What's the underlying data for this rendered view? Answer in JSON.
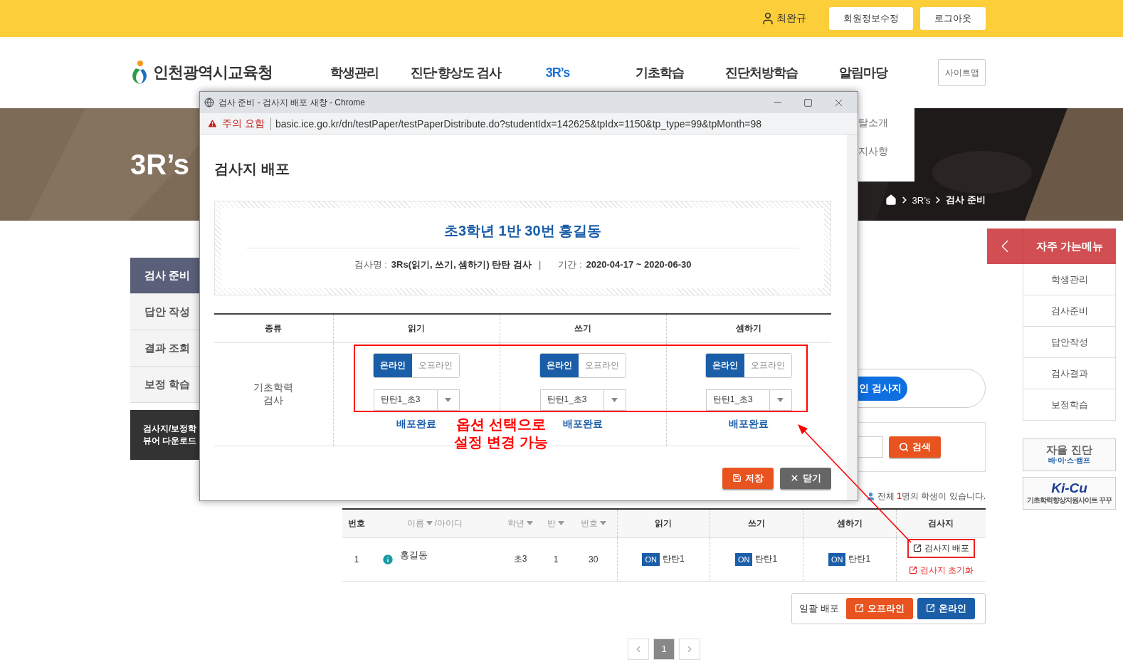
{
  "top_bar": {
    "user_name": "최완규",
    "buttons": [
      "회원정보수정",
      "로그아웃"
    ]
  },
  "header": {
    "logo_text": "인천광역시교육청",
    "nav": [
      {
        "label": "학생관리",
        "selected": false
      },
      {
        "label": "진단·향상도 검사",
        "selected": false
      },
      {
        "label": "3R’s",
        "selected": true
      },
      {
        "label": "기초학습",
        "selected": false
      },
      {
        "label": "진단처방학습",
        "selected": false
      },
      {
        "label": "알림마당",
        "selected": false
      }
    ],
    "sitemap_button": "사이트맵"
  },
  "submenu_fragments": [
    "탈소개",
    "지사항"
  ],
  "banner": {
    "title": "3R’s",
    "breadcrumb": [
      "3R’s",
      "검사 준비"
    ]
  },
  "sidebar": {
    "items": [
      {
        "label": "검사 준비",
        "selected": true
      },
      {
        "label": "답안 작성",
        "selected": false
      },
      {
        "label": "결과 조회",
        "selected": false
      },
      {
        "label": "보정 학습",
        "selected": false
      }
    ],
    "download_banner": "검사지/보정학\n뷰어 다운로드"
  },
  "main": {
    "type_options": [
      {
        "label": "인 검사지",
        "selected": true
      }
    ],
    "search_button": "검색",
    "count": "전체 **1**명의 학생이 있습니다.",
    "table": {
      "columns": [
        {
          "label": "번호",
          "sortable": false
        },
        {
          "label": "이름",
          "sortable": true,
          "suffix": "/아이디"
        },
        {
          "label": "학년",
          "sortable": true
        },
        {
          "label": "반",
          "sortable": true
        },
        {
          "label": "번호",
          "sortable": true
        },
        {
          "label": "읽기",
          "sortable": false
        },
        {
          "label": "쓰기",
          "sortable": false
        },
        {
          "label": "셈하기",
          "sortable": false
        },
        {
          "label": "검사지",
          "sortable": false
        }
      ],
      "rows": [
        {
          "no": "1",
          "name": "홍길동",
          "grade": "초3",
          "class": "1",
          "number": "30",
          "subjects": [
            {
              "mode": "ON",
              "paper": "탄탄1"
            },
            {
              "mode": "ON",
              "paper": "탄탄1"
            },
            {
              "mode": "ON",
              "paper": "탄탄1"
            }
          ],
          "actions": [
            {
              "label": "검사지 배포",
              "kind": "distribute",
              "highlighted": true
            },
            {
              "label": "검사지 초기화",
              "kind": "reset",
              "highlighted": false
            }
          ]
        }
      ]
    },
    "bulk": {
      "label": "일괄 배포",
      "buttons": [
        {
          "label": "오프라인",
          "kind": "offline"
        },
        {
          "label": "온라인",
          "kind": "online"
        }
      ]
    },
    "pagination": [
      {
        "label": "1",
        "selected": true
      }
    ]
  },
  "quick_menu": {
    "title": "자주 가는메뉴",
    "items": [
      "학생관리",
      "검사준비",
      "답안작성",
      "검사결과",
      "보정학습"
    ],
    "banners": [
      {
        "kind": "self",
        "title": "자율 진단",
        "subtitle": "배·이·스·캠프"
      },
      {
        "kind": "kicu",
        "title": "Ki-Cu",
        "subtitle": "기초학력향상지원사이트 꾸꾸"
      }
    ]
  },
  "popup": {
    "window_title": "검사 준비 - 검사지 배포 새창 - Chrome",
    "warning": "주의 요함",
    "url": "basic.ice.go.kr/dn/testPaper/testPaperDistribute.do?studentIdx=142625&tpIdx=1150&tp_type=99&tpMonth=98",
    "heading": "검사지 배포",
    "student": "초3학년 1반 30번 홍길동",
    "test_label": "검사명 :",
    "test_name": "3Rs(읽기, 쓰기, 셈하기) 탄탄 검사",
    "separator": "|",
    "period_label": "기간 :",
    "period": "2020-04-17 ~ 2020-06-30",
    "table": {
      "columns": [
        "종류",
        "읽기",
        "쓰기",
        "셈하기"
      ],
      "row_label": "기초학력\n검사",
      "cells": [
        {
          "modes": [
            {
              "label": "온라인",
              "selected": true
            },
            {
              "label": "오프라인",
              "selected": false
            }
          ],
          "paper": "탄탄1_초3",
          "status": "배포완료"
        },
        {
          "modes": [
            {
              "label": "온라인",
              "selected": true
            },
            {
              "label": "오프라인",
              "selected": false
            }
          ],
          "paper": "탄탄1_초3",
          "status": "배포완료"
        },
        {
          "modes": [
            {
              "label": "온라인",
              "selected": true
            },
            {
              "label": "오프라인",
              "selected": false
            }
          ],
          "paper": "탄탄1_초3",
          "status": "배포완료"
        }
      ]
    },
    "buttons": [
      {
        "label": "저장",
        "kind": "save"
      },
      {
        "label": "닫기",
        "kind": "close"
      }
    ]
  },
  "annotation": {
    "note": "옵션 선택으로\n설정 변경 가능"
  }
}
